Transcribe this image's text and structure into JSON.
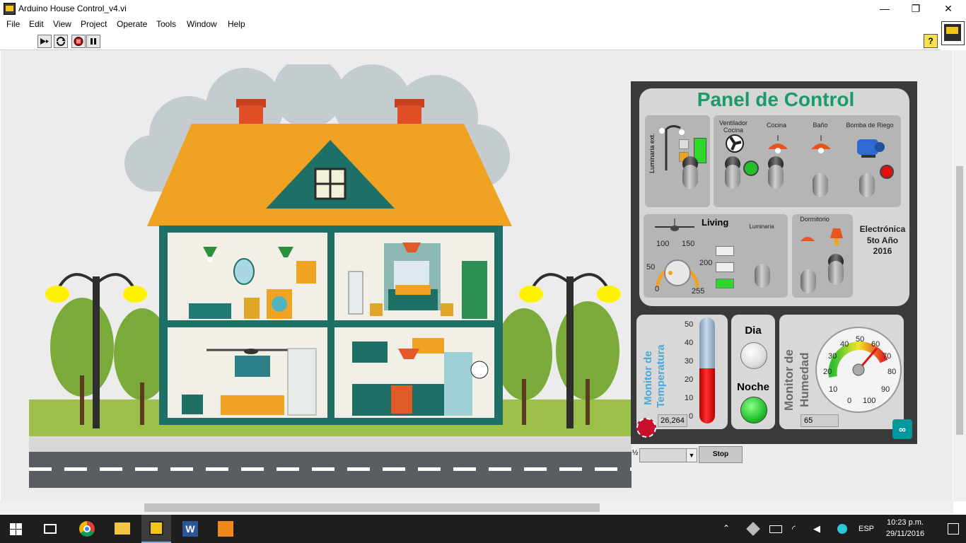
{
  "window": {
    "title": "Arduino House Control_v4.vi"
  },
  "window_controls": {
    "minimize": "—",
    "maximize": "❐",
    "close": "✕"
  },
  "menu": [
    "File",
    "Edit",
    "View",
    "Project",
    "Operate",
    "Tools",
    "Window",
    "Help"
  ],
  "help_button": "?",
  "panel": {
    "title": "Panel de Control",
    "luminaria_ext": "Luminaria ext.",
    "ventilador_cocina": "Ventilador Cocina",
    "cocina": "Cocina",
    "bano": "Baño",
    "bomba": "Bomba de Riego",
    "living": "Living",
    "luminaria": "Luminaria",
    "dormitorio": "Dormitorio",
    "electronica": "Electrónica",
    "anio": "5to Año",
    "year": "2016",
    "knob_ticks": [
      "0",
      "50",
      "100",
      "150",
      "200",
      "255"
    ],
    "temp_label_1": "Monitor de",
    "temp_label_2": "Temperatura",
    "temp_ticks": [
      "50",
      "40",
      "30",
      "20",
      "10",
      "0"
    ],
    "temp_value": "26,264",
    "temp_fill": 0.52,
    "dia": "Dia",
    "noche": "Noche",
    "hum_label_1": "Monitor de",
    "hum_label_2": "Humedad",
    "hum_ticks": [
      "0",
      "10",
      "20",
      "30",
      "40",
      "50",
      "60",
      "70",
      "80",
      "90",
      "100"
    ],
    "hum_value": "65"
  },
  "bottom": {
    "stop": "Stop",
    "ratio": "½"
  },
  "taskbar": {
    "time": "10:23 p.m.",
    "date": "29/11/2016",
    "lang": "ESP"
  },
  "colors": {
    "accent_green": "#2e9d6d",
    "roof": "#f0a222",
    "wall": "#1e6f66",
    "led_green": "#22c12a",
    "led_red": "#e01010"
  }
}
